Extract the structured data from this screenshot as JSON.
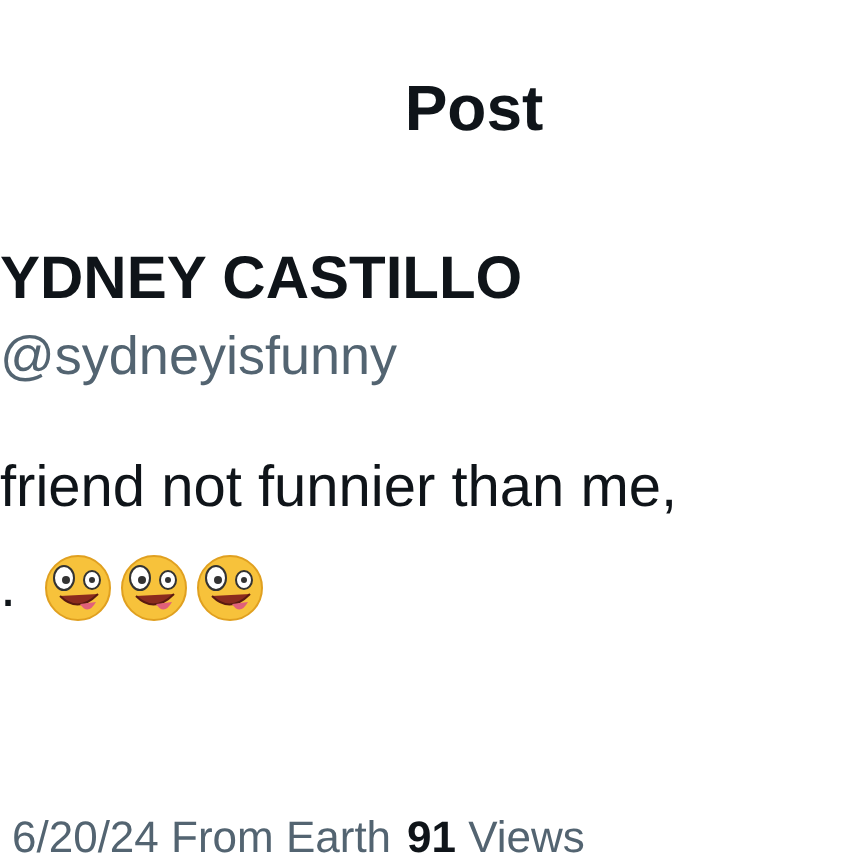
{
  "header": {
    "title": "Post"
  },
  "author": {
    "name": "YDNEY CASTILLO",
    "handle": "@sydneyisfunny"
  },
  "post": {
    "text": "friend not funnier than me,",
    "line_2": ".",
    "emojis": [
      {
        "kind": "zany"
      },
      {
        "kind": "zany"
      },
      {
        "kind": "zany"
      }
    ]
  },
  "meta": {
    "date": "6/20/24 From Earth",
    "views": "**91** Views"
  }
}
